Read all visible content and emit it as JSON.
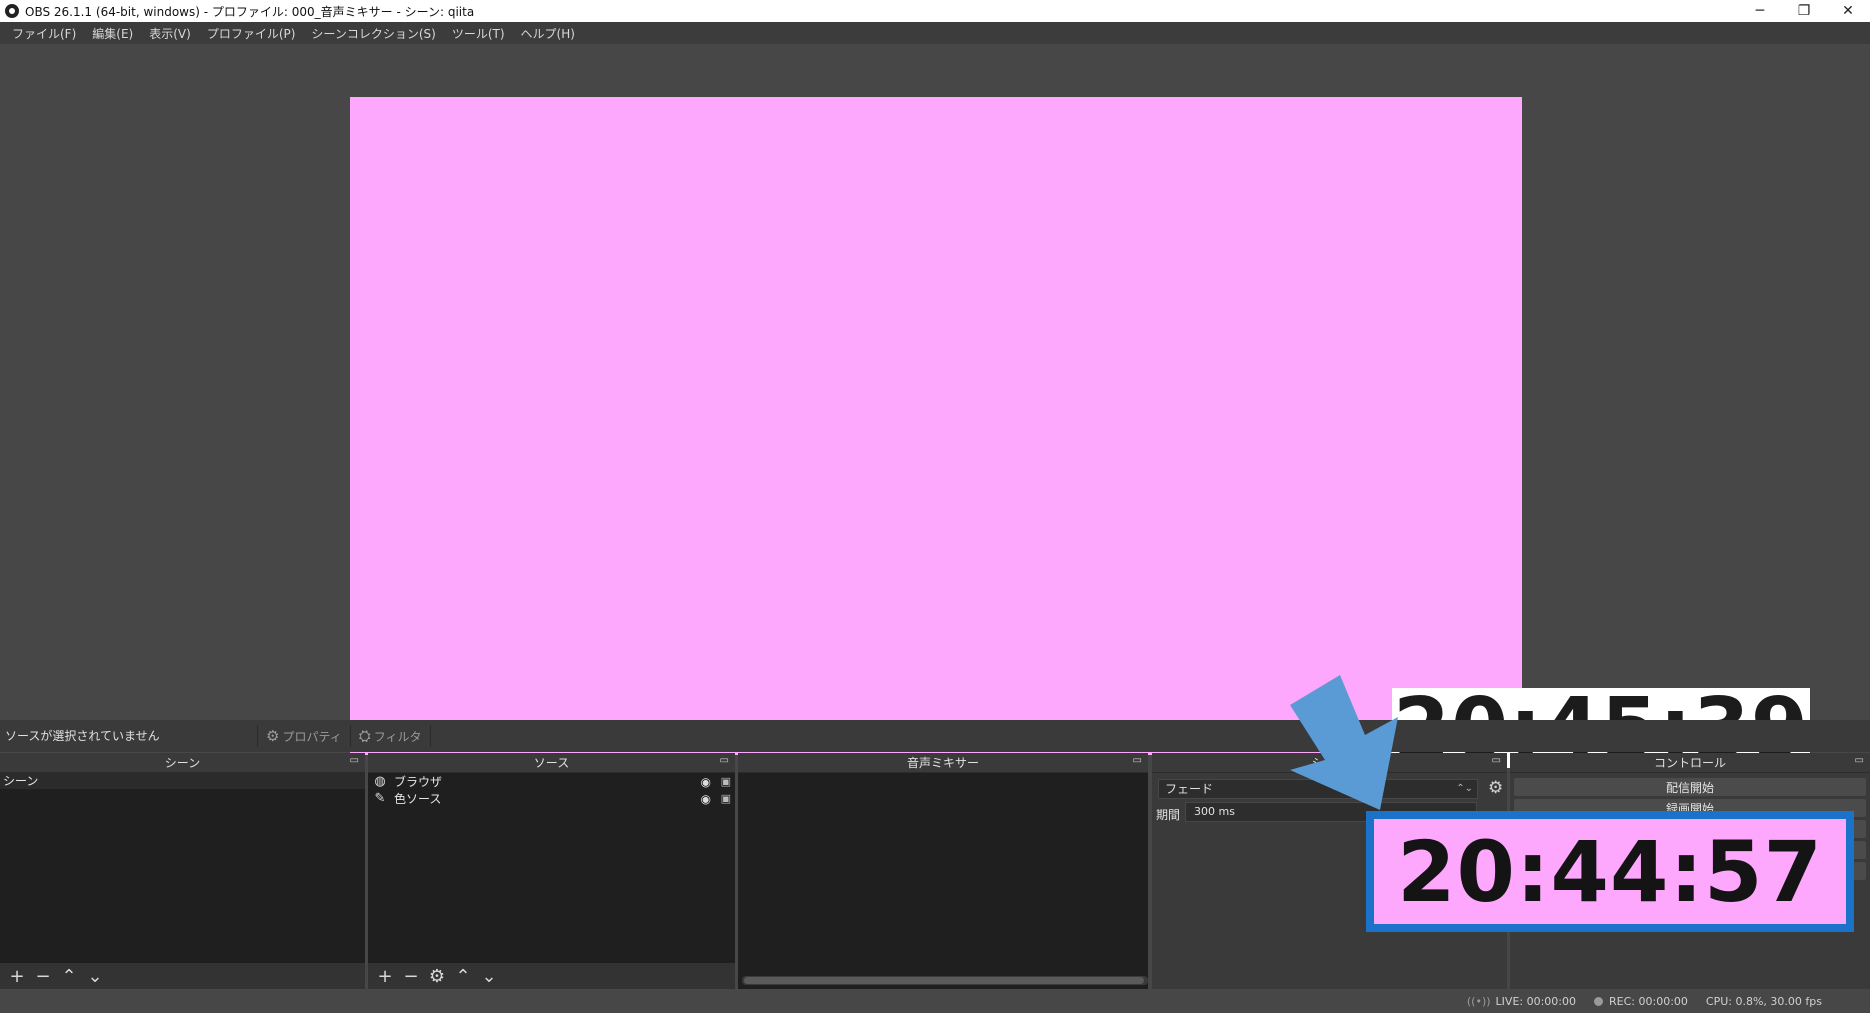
{
  "window": {
    "title": "OBS 26.1.1 (64-bit, windows) - プロファイル: 000_音声ミキサー - シーン: qiita",
    "minimize": "─",
    "restore": "❐",
    "close": "✕"
  },
  "menu": [
    {
      "label": "ファイル(F)"
    },
    {
      "label": "編集(E)"
    },
    {
      "label": "表示(V)"
    },
    {
      "label": "プロファイル(P)"
    },
    {
      "label": "シーンコレクション(S)"
    },
    {
      "label": "ツール(T)"
    },
    {
      "label": "ヘルプ(H)"
    }
  ],
  "preview": {
    "background_color": "#fea8fd",
    "clock_text": "20:45:39"
  },
  "source_toolbar": {
    "no_source": "ソースが選択されていません",
    "properties": "プロパティ",
    "filters": "フィルタ"
  },
  "docks": {
    "scenes": {
      "title": "シーン",
      "items": [
        {
          "label": "シーン"
        }
      ]
    },
    "sources": {
      "title": "ソース",
      "items": [
        {
          "label": "ブラウザ",
          "icon": "globe-icon"
        },
        {
          "label": "色ソース",
          "icon": "paint-brush-icon"
        }
      ]
    },
    "mixer": {
      "title": "音声ミキサー"
    },
    "transitions": {
      "title": "シーン",
      "selected": "フェード",
      "duration_label": "期間",
      "duration_value": "300 ms"
    },
    "controls": {
      "title": "コントロール",
      "buttons": [
        {
          "label": "配信開始"
        },
        {
          "label": "録画開始"
        }
      ]
    }
  },
  "status": {
    "live": "LIVE: 00:00:00",
    "rec": "REC: 00:00:00",
    "cpu": "CPU: 0.8%, 30.00 fps"
  },
  "annotation": {
    "zoomed_clock": "20:44:57",
    "arrow_color": "#5b9bd5",
    "frame_color": "#1a73c9"
  }
}
